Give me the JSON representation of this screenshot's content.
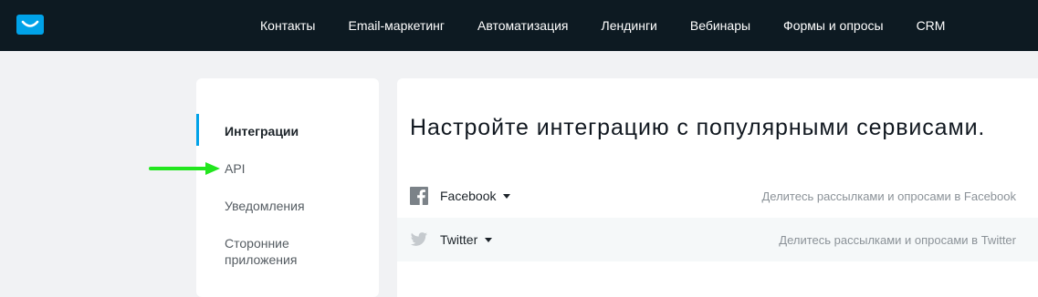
{
  "nav": {
    "items": [
      {
        "label": "Контакты"
      },
      {
        "label": "Email-маркетинг"
      },
      {
        "label": "Автоматизация"
      },
      {
        "label": "Лендинги"
      },
      {
        "label": "Вебинары"
      },
      {
        "label": "Формы и опросы"
      },
      {
        "label": "CRM"
      }
    ]
  },
  "sidebar": {
    "items": [
      {
        "label": "Интеграции",
        "active": true
      },
      {
        "label": "API"
      },
      {
        "label": "Уведомления"
      },
      {
        "label": "Сторонние приложения"
      }
    ]
  },
  "main": {
    "title": "Настройте интеграцию с популярными сервисами.",
    "rows": [
      {
        "name": "Facebook",
        "icon": "facebook-icon",
        "description": "Делитесь рассылками и опросами в Facebook"
      },
      {
        "name": "Twitter",
        "icon": "twitter-icon",
        "description": "Делитесь рассылками и опросами в Twitter"
      }
    ]
  },
  "colors": {
    "topbar": "#0d1a22",
    "logo": "#00a2e8",
    "active_marker": "#00a2e8",
    "annotation_arrow": "#22e61e"
  }
}
